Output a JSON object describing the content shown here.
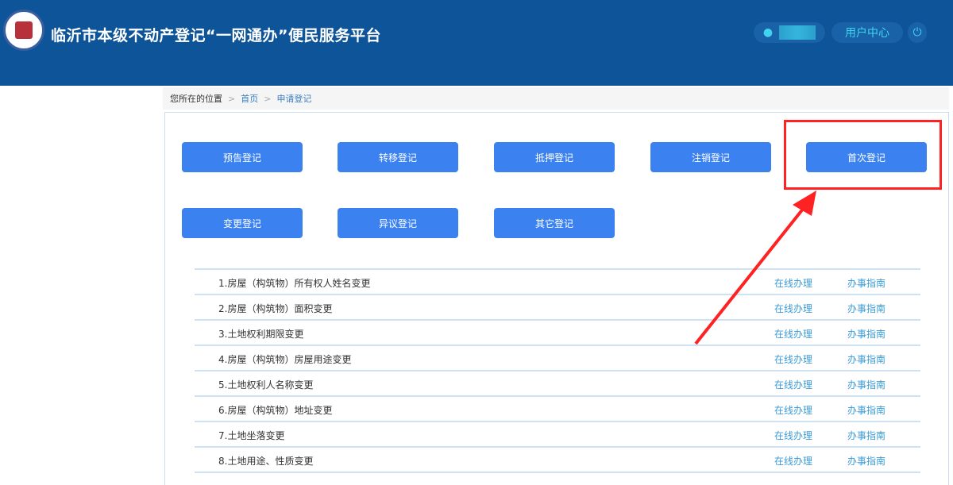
{
  "header": {
    "title": "临沂市本级不动产登记“一网通办”便民服务平台",
    "user_center": "用户中心",
    "icons": [
      "user-icon",
      "power-icon"
    ]
  },
  "breadcrumb": {
    "label": "您所在的位置",
    "home": "首页",
    "current": "申请登记"
  },
  "buttons": [
    "预告登记",
    "转移登记",
    "抵押登记",
    "注销登记",
    "首次登记",
    "变更登记",
    "异议登记",
    "其它登记"
  ],
  "list": {
    "online": "在线办理",
    "guide": "办事指南",
    "items": [
      "1.房屋（构筑物）所有权人姓名变更",
      "2.房屋（构筑物）面积变更",
      "3.土地权利期限变更",
      "4.房屋（构筑物）房屋用途变更",
      "5.土地权利人名称变更",
      "6.房屋（构筑物）地址变更",
      "7.土地坐落变更",
      "8.土地用途、性质变更"
    ]
  },
  "colors": {
    "header": "#0d5499",
    "button": "#3b82f0",
    "annotation": "#ff2222"
  }
}
